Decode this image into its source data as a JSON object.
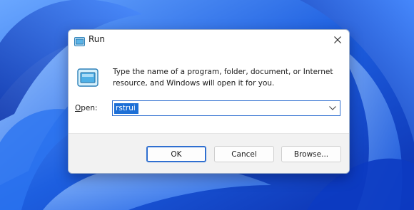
{
  "window": {
    "title": "Run",
    "icon": "run-icon",
    "close_icon": "close-icon"
  },
  "description": "Type the name of a program, folder, document, or Internet resource, and Windows will open it for you.",
  "open": {
    "label_accel": "O",
    "label_rest": "pen:",
    "value": "rstrui",
    "dropdown_icon": "chevron-down-icon"
  },
  "buttons": {
    "ok": "OK",
    "cancel": "Cancel",
    "browse": "Browse..."
  },
  "colors": {
    "accent": "#2f6fd0",
    "wallpaper": "#1b5de0"
  }
}
